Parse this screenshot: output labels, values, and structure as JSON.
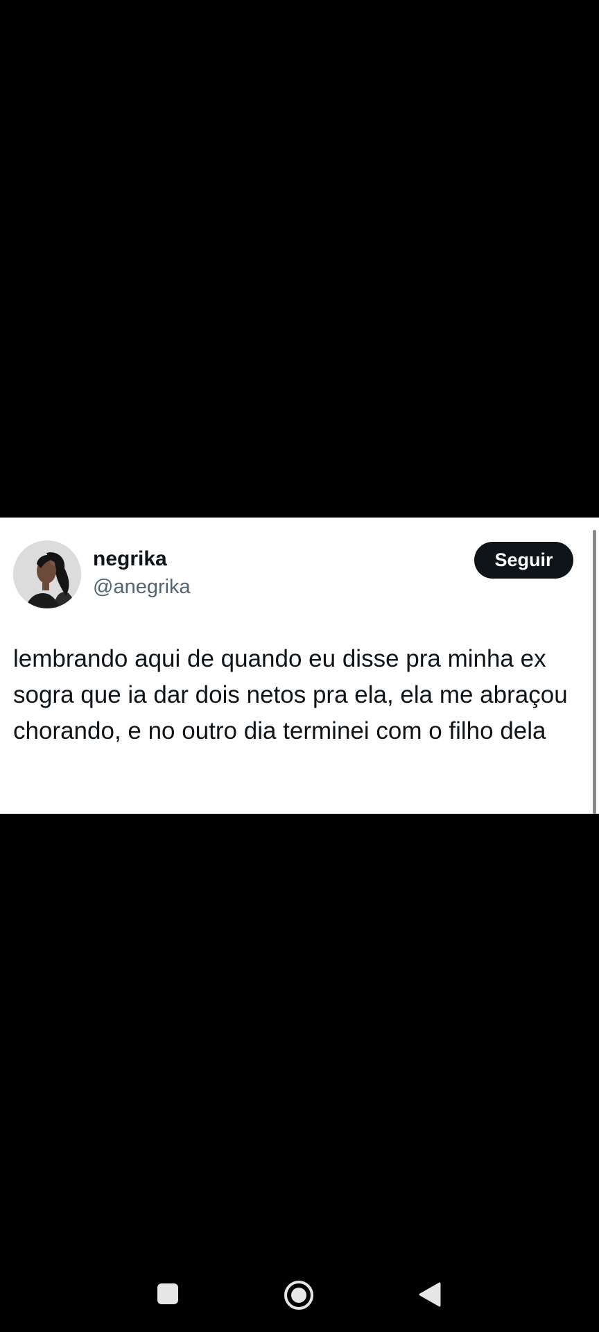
{
  "tweet": {
    "display_name": "negrika",
    "handle": "@anegrika",
    "follow_label": "Seguir",
    "text": "lembrando aqui de quando eu disse pra minha ex sogra que ia dar dois netos pra ela, ela me abraçou chorando, e no outro dia terminei com o filho dela"
  },
  "icons": {
    "recent_apps": "square-recent-apps-icon",
    "home": "circle-home-icon",
    "back": "triangle-back-icon"
  },
  "colors": {
    "background": "#000000",
    "card": "#ffffff",
    "text": "#0f1419",
    "handle": "#536471",
    "button": "#0f1419",
    "nav_icons": "#e6e6e6"
  }
}
